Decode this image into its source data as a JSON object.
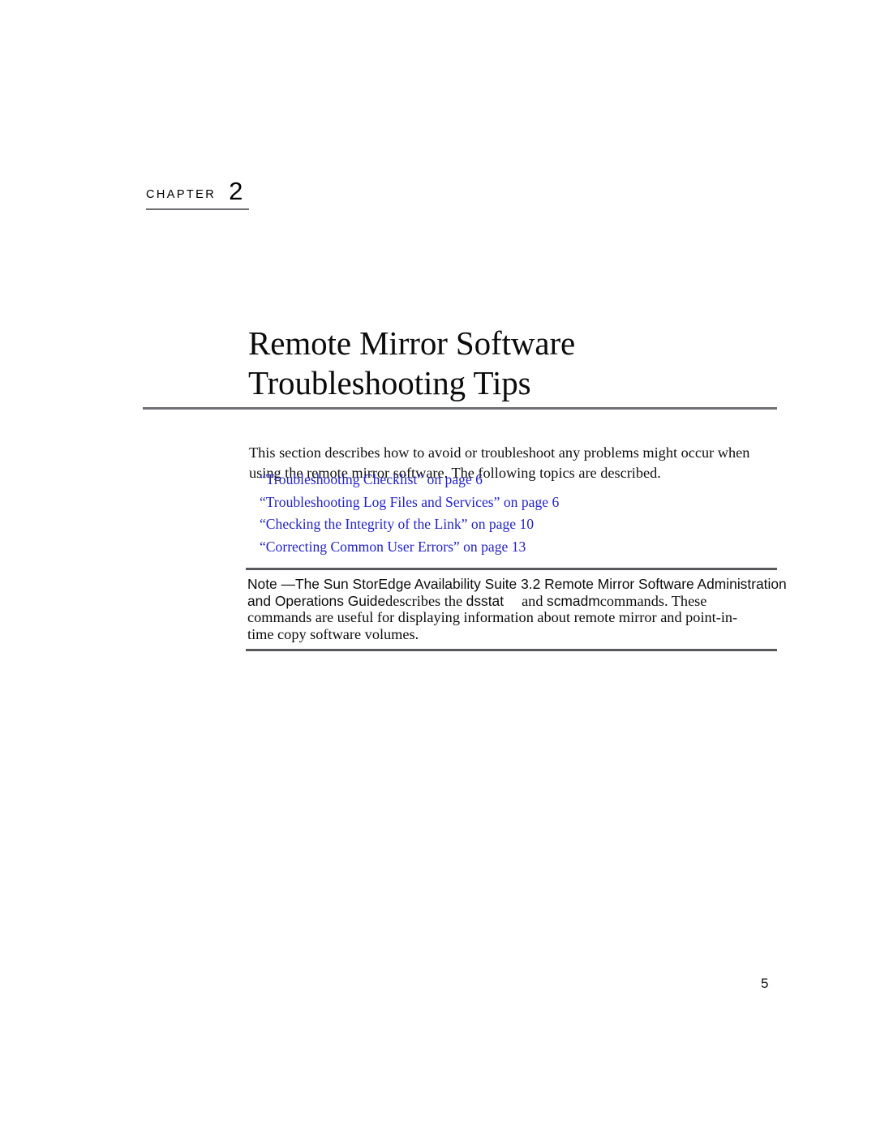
{
  "page": {
    "background_color": "#ffffff",
    "folio": "5"
  },
  "chapter": {
    "label": "CHAPTER",
    "number": "2"
  },
  "title": {
    "line1": "Remote Mirror Software",
    "line2": "Troubleshooting Tips"
  },
  "intro": {
    "line1": "This section describes how to avoid or troubleshoot any problems might occur when",
    "line2": "using the remote mirror software. The following topics are described."
  },
  "cross_references": {
    "link_color": "#2323c8",
    "items": [
      {
        "text": "“Troubleshooting Checklist” on page 6",
        "title": "Troubleshooting Checklist",
        "page": "6"
      },
      {
        "text": "“Troubleshooting Log Files and Services” on page 6",
        "title": "Troubleshooting Log Files and Services",
        "page": "6"
      },
      {
        "text": "“Checking the Integrity of the Link” on page 10",
        "title": "Checking the Integrity of the Link",
        "page": "10"
      },
      {
        "text": "“Correcting Common User Errors” on page 13",
        "title": "Correcting Common User Errors",
        "page": "13"
      }
    ]
  },
  "note": {
    "rule_color": "#58595c",
    "lead": "Note —",
    "line1_rest": "The Sun StorEdge Availability Suite 3.2 Remote Mirror Software Administration",
    "line2_guide": "and Operations Guide",
    "line2_a": "describes the ",
    "line2_cmd1": "dsstat",
    "line2_b": "and ",
    "line2_cmd2": "scmadm",
    "line2_c": "commands. These",
    "line3": "commands are useful for displaying information about remote mirror and point-in-",
    "line4": "time copy software volumes."
  }
}
